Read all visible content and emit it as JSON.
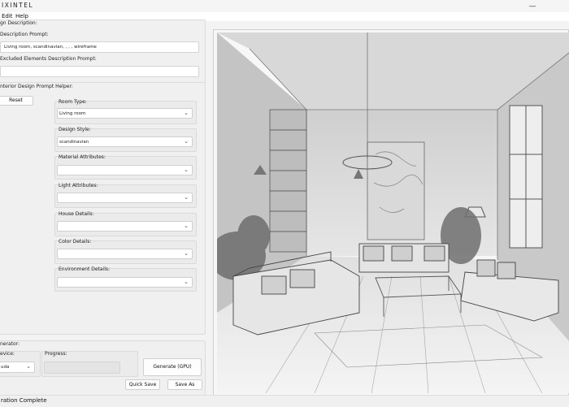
{
  "window": {
    "title": "IXINTEL",
    "minimize_icon": "minimize-icon"
  },
  "menu": [
    "Edit",
    "Help"
  ],
  "description_section": {
    "title": "gn Description:",
    "prompt_label": "Description Prompt:",
    "prompt_value": "Living room, scandinavian, , , , wireframe",
    "excluded_label": "Excluded Elements Description Prompt:",
    "excluded_value": ""
  },
  "helper_section": {
    "title": "nterior Design Prompt Helper:",
    "reset_label": "Reset",
    "fields": [
      {
        "label": "Room Type:",
        "value": "Living room"
      },
      {
        "label": "Design Style:",
        "value": "scandinavian"
      },
      {
        "label": "Material Attributes:",
        "value": ""
      },
      {
        "label": "Light Attributes:",
        "value": ""
      },
      {
        "label": "House Details:",
        "value": ""
      },
      {
        "label": "Color Details:",
        "value": ""
      },
      {
        "label": "Environment Details:",
        "value": ""
      }
    ]
  },
  "generator_section": {
    "title": "nerator:",
    "device_label": "evice:",
    "device_value": "uda",
    "progress_label": "Progress:",
    "progress": 0,
    "generate_label": "Generate (GPU)",
    "quick_save_label": "Quick Save",
    "save_as_label": "Save As"
  },
  "status": "ration Complete",
  "colors": {
    "background": "#f3f3f3",
    "panel_border": "#dcdcdc",
    "accent": "#ffffff"
  }
}
